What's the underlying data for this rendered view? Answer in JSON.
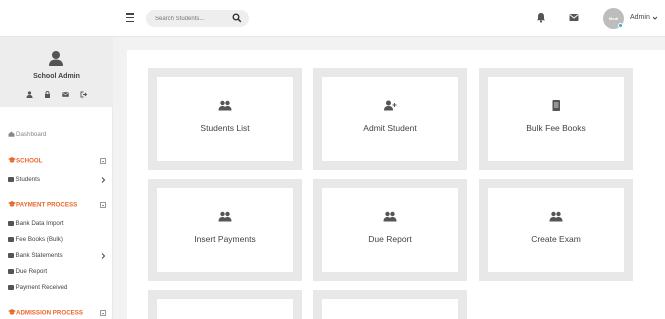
{
  "topbar": {
    "search_placeholder": "Search Students...",
    "user_name": "Admin",
    "avatar_text": "Modi"
  },
  "sidebar": {
    "profile_name": "School Admin",
    "dashboard": "Dashboard",
    "sections": [
      {
        "title": "SCHOOL",
        "items": [
          "Students"
        ]
      },
      {
        "title": "PAYMENT PROCESS",
        "items": [
          "Bank Data Import",
          "Fee Books (Bulk)",
          "Bank Statements",
          "Due Report",
          "Payment Received"
        ]
      },
      {
        "title": "ADMISSION PROCESS",
        "items": []
      }
    ]
  },
  "tiles": [
    {
      "label": "Students List",
      "icon": "users-icon"
    },
    {
      "label": "Admit Student",
      "icon": "user-plus-icon"
    },
    {
      "label": "Bulk Fee Books",
      "icon": "book-icon"
    },
    {
      "label": "Insert Payments",
      "icon": "users-icon"
    },
    {
      "label": "Due Report",
      "icon": "users-icon"
    },
    {
      "label": "Create Exam",
      "icon": "users-icon"
    }
  ],
  "colors": {
    "accent": "#e8672a",
    "tile_bg": "#e8e8e8",
    "status_dot": "#3fa7e0"
  }
}
